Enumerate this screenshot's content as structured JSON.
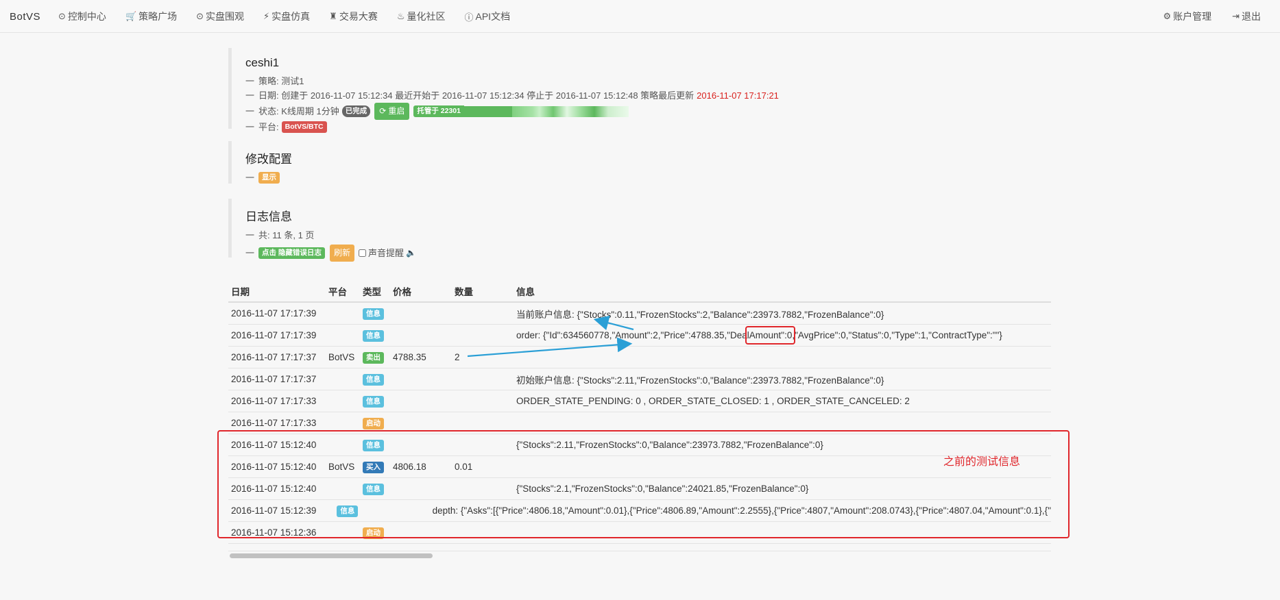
{
  "nav": {
    "brand": "BotVS",
    "items": [
      {
        "icon": "clock-icon",
        "glyph": "⊙",
        "label": "控制中心"
      },
      {
        "icon": "cart-icon",
        "glyph": "🛒",
        "label": "策略广场"
      },
      {
        "icon": "play-circle-icon",
        "glyph": "⊙",
        "label": "实盘围观"
      },
      {
        "icon": "lightning-icon",
        "glyph": "⚡",
        "label": "实盘仿真"
      },
      {
        "icon": "tower-icon",
        "glyph": "♜",
        "label": "交易大赛"
      },
      {
        "icon": "fire-icon",
        "glyph": "♨",
        "label": "量化社区"
      },
      {
        "icon": "info-circle-icon",
        "glyph": "ⓘ",
        "label": "API文档"
      }
    ],
    "right": [
      {
        "icon": "gear-icon",
        "glyph": "⚙",
        "label": "账户管理"
      },
      {
        "icon": "logout-icon",
        "glyph": "⇥",
        "label": "退出"
      }
    ]
  },
  "robot": {
    "name": "ceshi1",
    "dash": "一",
    "strategy_label": "策略: 测试1",
    "date_text": "日期: 创建于 2016-11-07 15:12:34 最近开始于 2016-11-07 15:12:34 停止于 2016-11-07 15:12:48 策略最后更新",
    "last_update": "2016-11-07 17:17:21",
    "status_text": "状态: K线周期 1分钟",
    "status_badge": "已完成",
    "restart_label": "重启",
    "hosted_label": "托管于 22301",
    "platform_label": "平台:",
    "platform_badge": "BotVS/BTC"
  },
  "config": {
    "title": "修改配置",
    "show_badge": "显示"
  },
  "log": {
    "title": "日志信息",
    "count_text": "共: 11 条, 1 页",
    "hide_errors_label": "点击 隐藏错误日志",
    "refresh_label": "刷新",
    "sound_label": "声音提醒",
    "headers": {
      "date": "日期",
      "platform": "平台",
      "type": "类型",
      "price": "价格",
      "qty": "数量",
      "info": "信息"
    },
    "rows": [
      {
        "date": "2016-11-07 17:17:39",
        "platform": "",
        "type": "信息",
        "type_color": "#5bc0de",
        "price": "",
        "qty": "",
        "info": "当前账户信息:  {\"Stocks\":0.11,\"FrozenStocks\":2,\"Balance\":23973.7882,\"FrozenBalance\":0}"
      },
      {
        "date": "2016-11-07 17:17:39",
        "platform": "",
        "type": "信息",
        "type_color": "#5bc0de",
        "price": "",
        "qty": "",
        "info": "order: {\"Id\":634560778,\"Amount\":2,\"Price\":4788.35,\"DealAmount\":0,\"AvgPrice\":0,\"Status\":0,\"Type\":1,\"ContractType\":\"\"}"
      },
      {
        "date": "2016-11-07 17:17:37",
        "platform": "BotVS",
        "type": "卖出",
        "type_color": "#5cb85c",
        "price": "4788.35",
        "qty": "2",
        "info": ""
      },
      {
        "date": "2016-11-07 17:17:37",
        "platform": "",
        "type": "信息",
        "type_color": "#5bc0de",
        "price": "",
        "qty": "",
        "info": "初始账户信息:  {\"Stocks\":2.11,\"FrozenStocks\":0,\"Balance\":23973.7882,\"FrozenBalance\":0}"
      },
      {
        "date": "2016-11-07 17:17:33",
        "platform": "",
        "type": "信息",
        "type_color": "#5bc0de",
        "price": "",
        "qty": "",
        "info": "ORDER_STATE_PENDING: 0 , ORDER_STATE_CLOSED: 1 , ORDER_STATE_CANCELED: 2"
      },
      {
        "date": "2016-11-07 17:17:33",
        "platform": "",
        "type": "启动",
        "type_color": "#f0ad4e",
        "price": "",
        "qty": "",
        "info": ""
      },
      {
        "date": "2016-11-07 15:12:40",
        "platform": "",
        "type": "信息",
        "type_color": "#5bc0de",
        "price": "",
        "qty": "",
        "info": "{\"Stocks\":2.11,\"FrozenStocks\":0,\"Balance\":23973.7882,\"FrozenBalance\":0}"
      },
      {
        "date": "2016-11-07 15:12:40",
        "platform": "BotVS",
        "type": "买入",
        "type_color": "#337ab7",
        "price": "4806.18",
        "qty": "0.01",
        "info": ""
      },
      {
        "date": "2016-11-07 15:12:40",
        "platform": "",
        "type": "信息",
        "type_color": "#5bc0de",
        "price": "",
        "qty": "",
        "info": "{\"Stocks\":2.1,\"FrozenStocks\":0,\"Balance\":24021.85,\"FrozenBalance\":0}"
      },
      {
        "date": "2016-11-07 15:12:39",
        "platform": "",
        "type": "信息",
        "type_color": "#5bc0de",
        "price": "",
        "qty": "",
        "info": "depth: {\"Asks\":[{\"Price\":4806.18,\"Amount\":0.01},{\"Price\":4806.89,\"Amount\":2.2555},{\"Price\":4807,\"Amount\":208.0743},{\"Price\":4807.04,\"Amount\":0.1},{\""
      },
      {
        "date": "2016-11-07 15:12:36",
        "platform": "",
        "type": "启动",
        "type_color": "#f0ad4e",
        "price": "",
        "qty": "",
        "info": ""
      }
    ]
  },
  "annotation": {
    "note": "之前的测试信息",
    "color": "#e0262b",
    "arrow_color": "#2a9fd6"
  }
}
